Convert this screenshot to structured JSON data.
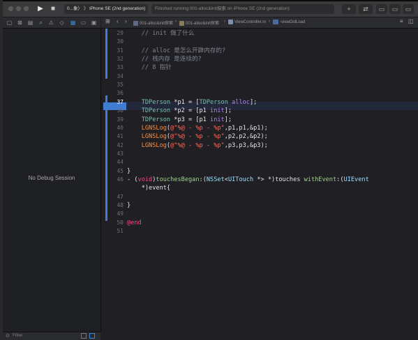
{
  "toolbar": {
    "scheme_label": "0...象）  〉  iPhone SE (2nd generation)",
    "status_text": "Finished running 001-alloc&init探索 on iPhone SE (2nd generation)"
  },
  "debug": {
    "empty_label": "No Debug Session"
  },
  "filter": {
    "placeholder": "Filter"
  },
  "jumpbar": {
    "crumbs": [
      "001-alloc&init探索",
      "001-alloc&init探索",
      "ViewController.m",
      "-viewDidLoad"
    ]
  },
  "editor": {
    "current_line": "37",
    "lines": [
      {
        "num": "29",
        "text": "    // init 做了什么"
      },
      {
        "num": "30",
        "text": ""
      },
      {
        "num": "31",
        "text": "    // alloc 是怎么开辟内存的?"
      },
      {
        "num": "32",
        "text": "    // 栈内存 是连续的?"
      },
      {
        "num": "33",
        "text": "    // 8 指针"
      },
      {
        "num": "34",
        "text": ""
      },
      {
        "num": "35",
        "text": ""
      },
      {
        "num": "36",
        "text": ""
      },
      {
        "num": "37",
        "text": "    TDPerson *p1 = [TDPerson alloc];"
      },
      {
        "num": "38",
        "text": "    TDPerson *p2 = [p1 init];"
      },
      {
        "num": "39",
        "text": "    TDPerson *p3 = [p1 init];"
      },
      {
        "num": "40",
        "text": "    LGNSLog(@\"%@ - %p - %p\",p1,p1,&p1);"
      },
      {
        "num": "41",
        "text": "    LGNSLog(@\"%@ - %p - %p\",p2,p2,&p2);"
      },
      {
        "num": "42",
        "text": "    LGNSLog(@\"%@ - %p - %p\",p3,p3,&p3);"
      },
      {
        "num": "43",
        "text": ""
      },
      {
        "num": "44",
        "text": ""
      },
      {
        "num": "45",
        "text": "}"
      },
      {
        "num": "46",
        "text": "- (void)touchesBegan:(NSSet<UITouch *> *)touches withEvent:(UIEvent"
      },
      {
        "num": "",
        "text": "    *)event{"
      },
      {
        "num": "47",
        "text": ""
      },
      {
        "num": "48",
        "text": "}"
      },
      {
        "num": "49",
        "text": ""
      },
      {
        "num": "50",
        "text": "@end"
      },
      {
        "num": "51",
        "text": ""
      }
    ]
  },
  "colors": {
    "accent": "#3f7cd4",
    "keyword": "#f4488f",
    "comment": "#7d8591",
    "string": "#fc6a5d"
  }
}
